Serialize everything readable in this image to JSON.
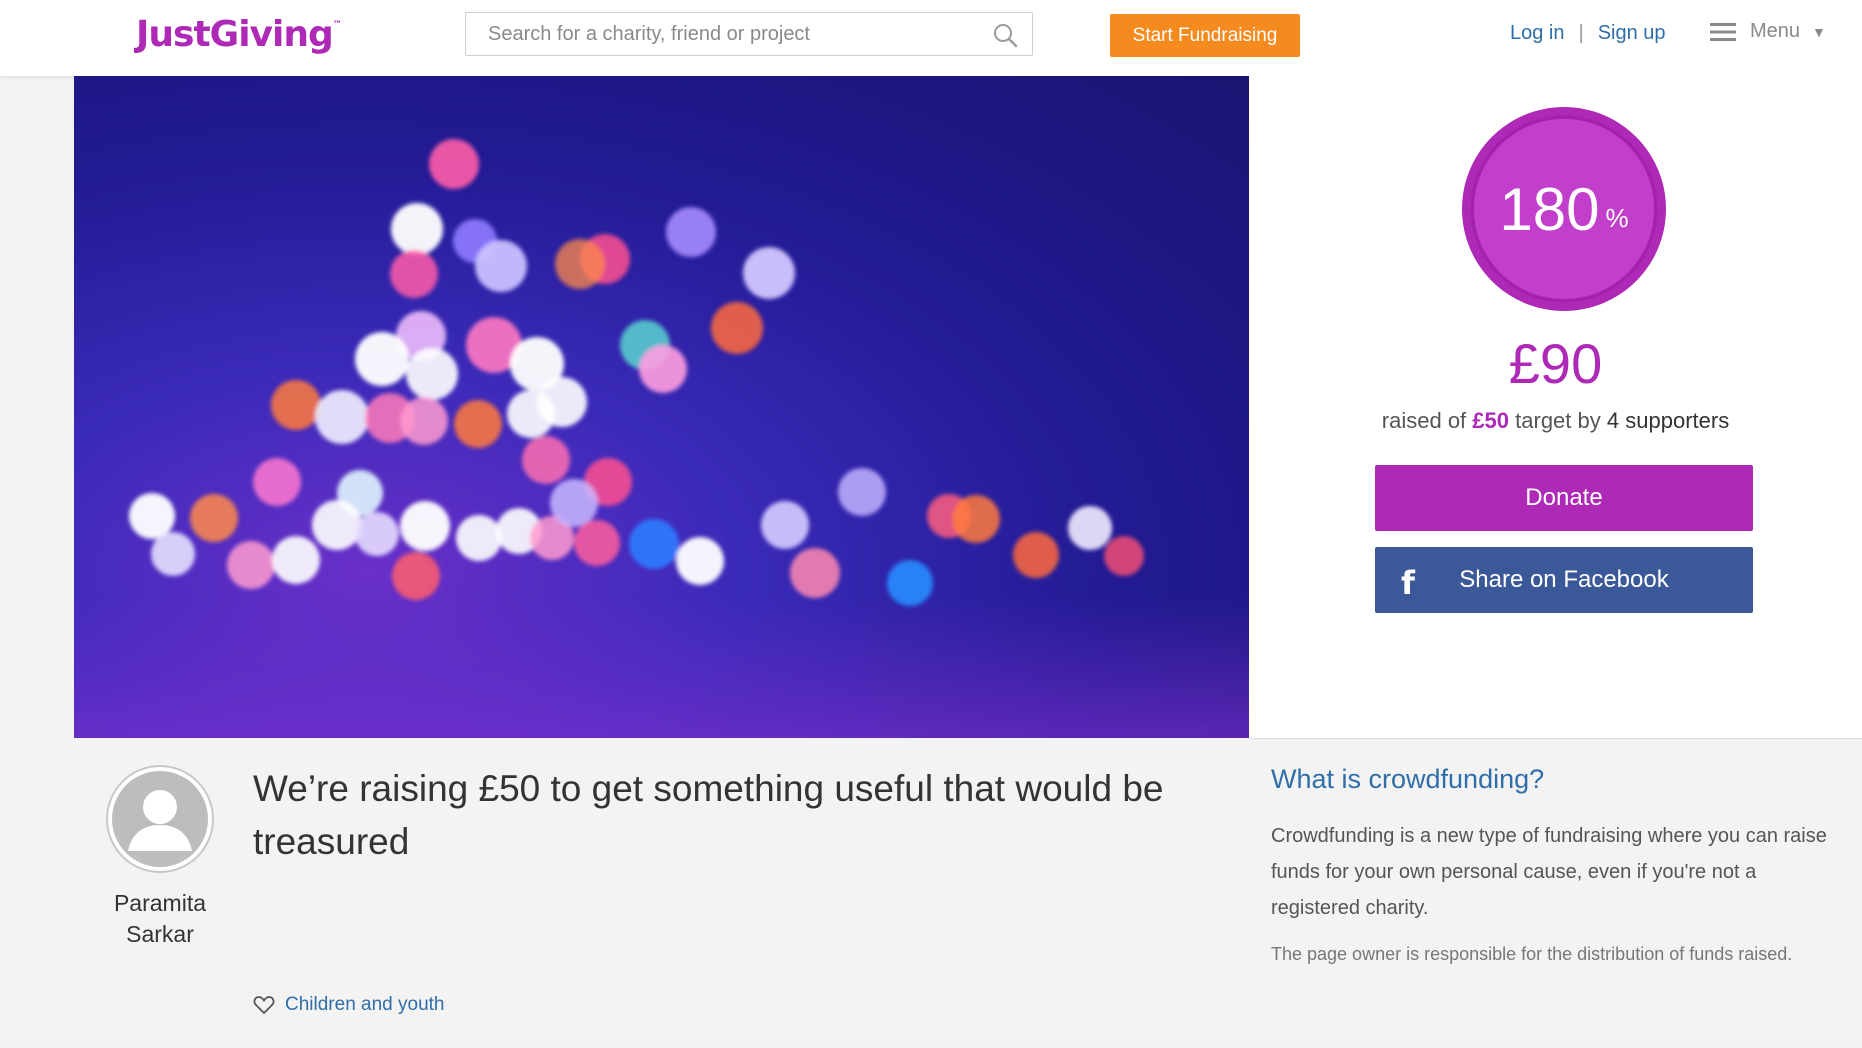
{
  "header": {
    "logo": "JustGiving",
    "logo_tm": "™",
    "search_placeholder": "Search for a charity, friend or project",
    "start_button": "Start Fundraising",
    "login": "Log in",
    "separator": "|",
    "signup": "Sign up",
    "menu": "Menu",
    "menu_chevron": "▼"
  },
  "progress": {
    "percent": "180",
    "percent_symbol": "%",
    "ring_color": "#ad29b6",
    "raised": "£90",
    "target_prefix": "raised of",
    "target_amount": "£50",
    "target_mid": "target by",
    "supporters_count": "4",
    "supporters_label": "supporters"
  },
  "actions": {
    "donate": "Donate",
    "share_facebook": "Share on Facebook",
    "facebook_icon": "f"
  },
  "page": {
    "title": "We’re raising £50 to get something useful that would be treasured",
    "owner": "Paramita Sarkar",
    "category": "Children and youth"
  },
  "info": {
    "heading": "What is crowdfunding?",
    "body": "Crowdfunding is a new type of fundraising where you can raise funds for your own personal cause, even if you're not a registered charity.",
    "note": "The page owner is responsible for the distribution of funds raised."
  },
  "colors": {
    "brand": "#ad29b6",
    "accent_orange": "#f58a1f",
    "facebook": "#3b5998",
    "link": "#2f6ea8"
  }
}
